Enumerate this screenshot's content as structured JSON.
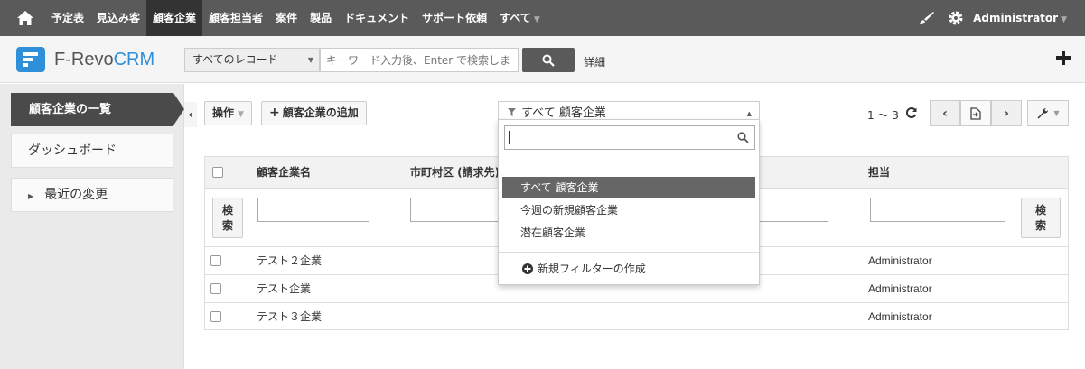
{
  "topnav": {
    "menu": [
      "予定表",
      "見込み客",
      "顧客企業",
      "顧客担当者",
      "案件",
      "製品",
      "ドキュメント",
      "サポート依頼",
      "すべて"
    ],
    "active_index": 2,
    "user": "Administrator"
  },
  "header": {
    "logo_main": "F-Revo",
    "logo_accent": "CRM",
    "record_select": "すべてのレコード",
    "search_placeholder": "キーワード入力後、Enter で検索しま",
    "detail_link": "詳細"
  },
  "sidebar": {
    "active_label": "顧客企業の一覧",
    "dashboard_label": "ダッシュボード",
    "recent_label": "最近の変更"
  },
  "toolbar": {
    "actions_label": "操作",
    "add_label": "顧客企業の追加",
    "filter_current": "すべて 顧客企業",
    "pager_text": "1 ～ 3"
  },
  "table": {
    "headers": {
      "name": "顧客企業名",
      "city": "市町村区 (請求先)",
      "owner": "担当"
    },
    "search_button_line1": "検",
    "search_button_line2": "索",
    "rows": [
      {
        "name": "テスト２企業",
        "owner": "Administrator"
      },
      {
        "name": "テスト企業",
        "owner": "Administrator"
      },
      {
        "name": "テスト３企業",
        "owner": "Administrator"
      }
    ]
  },
  "dropdown": {
    "items": [
      "すべて 顧客企業",
      "今週の新規顧客企業",
      "潜在顧客企業"
    ],
    "selected_index": 0,
    "new_filter_label": "新規フィルターの作成"
  },
  "colors": {
    "nav_bg": "#5a5a5a",
    "brand": "#2f8fd8",
    "sidebar_active": "#4a4a4a"
  }
}
